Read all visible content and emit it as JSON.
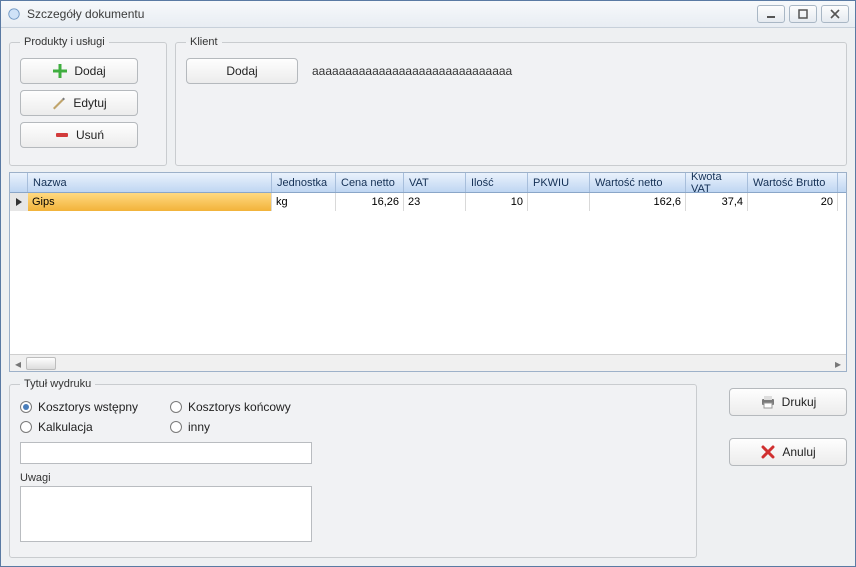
{
  "window": {
    "title": "Szczegóły dokumentu"
  },
  "products": {
    "legend": "Produkty i usługi",
    "add": "Dodaj",
    "edit": "Edytuj",
    "delete": "Usuń"
  },
  "klient": {
    "legend": "Klient",
    "add": "Dodaj",
    "name": "aaaaaaaaaaaaaaaaaaaaaaaaaaaaaa"
  },
  "grid": {
    "headers": {
      "nazwa": "Nazwa",
      "jednostka": "Jednostka",
      "cena_netto": "Cena netto",
      "vat": "VAT",
      "ilosc": "Ilość",
      "pkwiu": "PKWIU",
      "wartosc_netto": "Wartość netto",
      "kwota_vat": "Kwota VAT",
      "wartosc_brutto": "Wartość Brutto"
    },
    "rows": [
      {
        "nazwa": "Gips",
        "jednostka": "kg",
        "cena_netto": "16,26",
        "vat": "23",
        "ilosc": "10",
        "pkwiu": "",
        "wartosc_netto": "162,6",
        "kwota_vat": "37,4",
        "wartosc_brutto": "20"
      }
    ]
  },
  "print": {
    "legend": "Tytuł wydruku",
    "opt_wstepny": "Kosztorys wstępny",
    "opt_koncowy": "Kosztorys końcowy",
    "opt_kalkulacja": "Kalkulacja",
    "opt_inny": "inny",
    "selected": "wstepny",
    "custom_title": "",
    "remarks_label": "Uwagi",
    "remarks": ""
  },
  "actions": {
    "print": "Drukuj",
    "cancel": "Anuluj"
  }
}
